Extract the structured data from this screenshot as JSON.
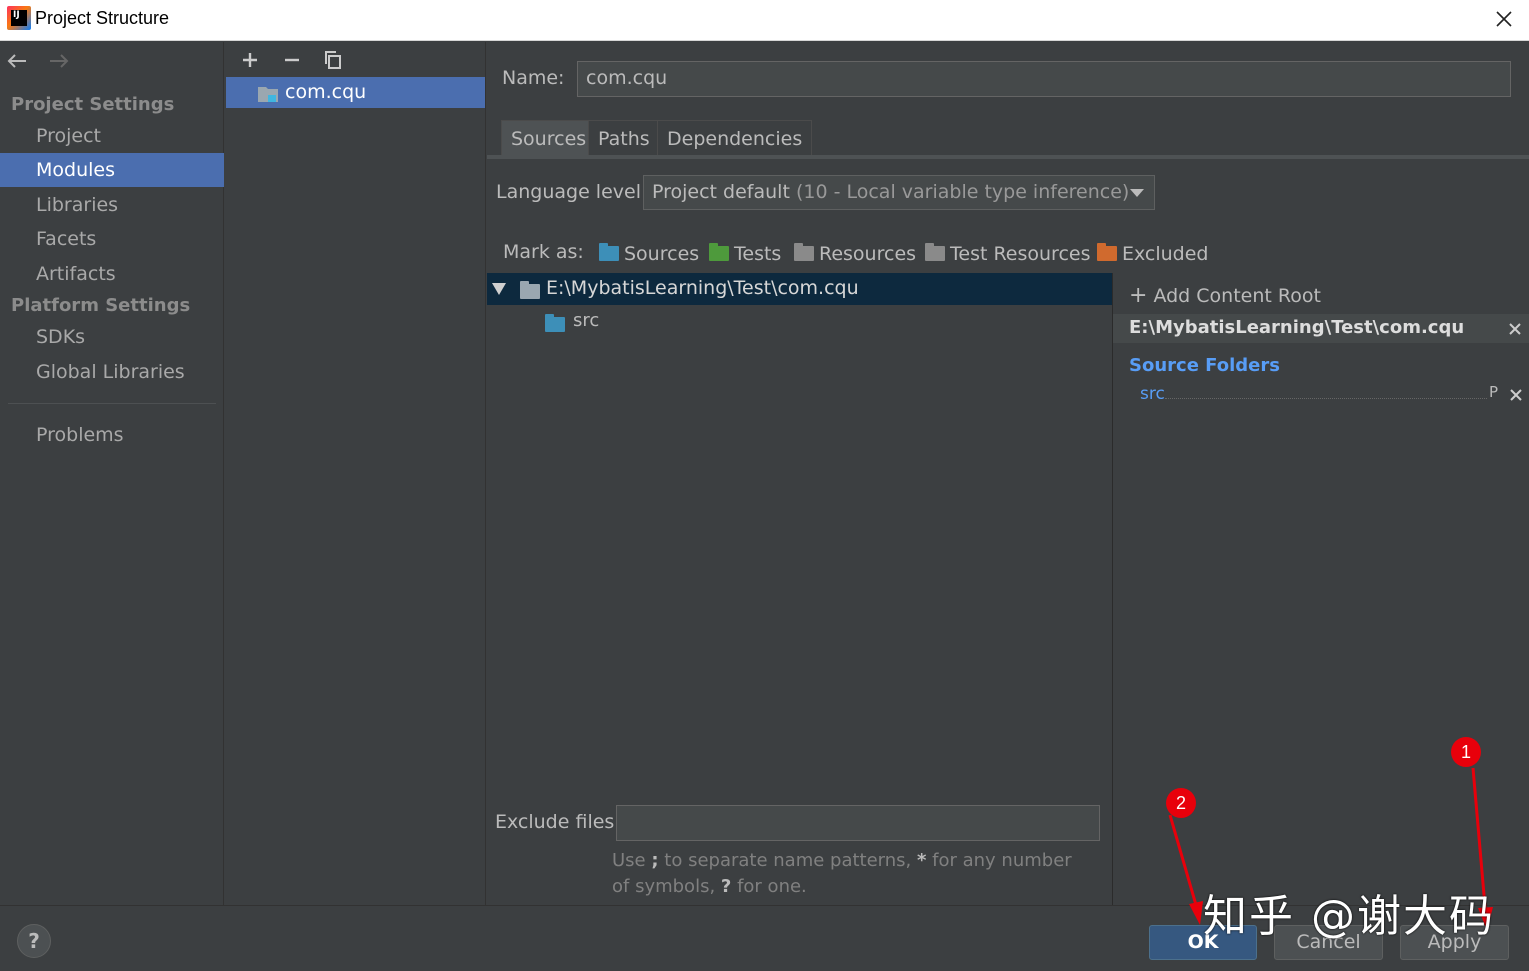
{
  "window": {
    "title": "Project Structure"
  },
  "nav": {
    "project_settings": "Project Settings",
    "platform_settings": "Platform Settings",
    "items": [
      {
        "label": "Project"
      },
      {
        "label": "Modules"
      },
      {
        "label": "Libraries"
      },
      {
        "label": "Facets"
      },
      {
        "label": "Artifacts"
      },
      {
        "label": "SDKs"
      },
      {
        "label": "Global Libraries"
      },
      {
        "label": "Problems"
      }
    ],
    "selected": "Modules"
  },
  "modules": {
    "items": [
      {
        "label": "com.cqu"
      }
    ]
  },
  "module": {
    "name_label": "Name:",
    "name_value": "com.cqu",
    "tabs": [
      {
        "label": "Sources"
      },
      {
        "label": "Paths"
      },
      {
        "label": "Dependencies"
      }
    ],
    "active_tab": "Sources",
    "language_level_label": "Language level:",
    "language_level_value": "Project default",
    "language_level_detail": "(10 - Local variable type inference)",
    "mark_as_label": "Mark as:",
    "mark_as": [
      {
        "label": "Sources",
        "color": "#3d8fb8"
      },
      {
        "label": "Tests",
        "color": "#4e9a3c"
      },
      {
        "label": "Resources",
        "color": "#8a8a8a"
      },
      {
        "label": "Test Resources",
        "color": "#8a8a8a"
      },
      {
        "label": "Excluded",
        "color": "#d06a2e"
      }
    ],
    "tree": {
      "root": "E:\\MybatisLearning\\Test\\com.cqu",
      "child": "src"
    },
    "exclude_label": "Exclude files:",
    "exclude_value": "",
    "hint_part1": "Use ",
    "hint_semicolon": ";",
    "hint_part2": " to separate name patterns, ",
    "hint_star": "*",
    "hint_part3": " for any number of symbols, ",
    "hint_q": "?",
    "hint_part4": " for one."
  },
  "content_root": {
    "add_label": "Add Content Root",
    "path": "E:\\MybatisLearning\\Test\\com.cqu",
    "source_folders_title": "Source Folders",
    "source_folder": "src",
    "p_label": "P"
  },
  "footer": {
    "help": "?",
    "ok": "OK",
    "cancel": "Cancel",
    "apply": "Apply"
  },
  "annotations": {
    "badge1": "1",
    "badge2": "2",
    "watermark": "知乎 @谢大码"
  },
  "colors": {
    "accent": "#4b6eaf",
    "ok_button": "#365880",
    "link": "#589df6",
    "annotation": "#e8000b"
  }
}
